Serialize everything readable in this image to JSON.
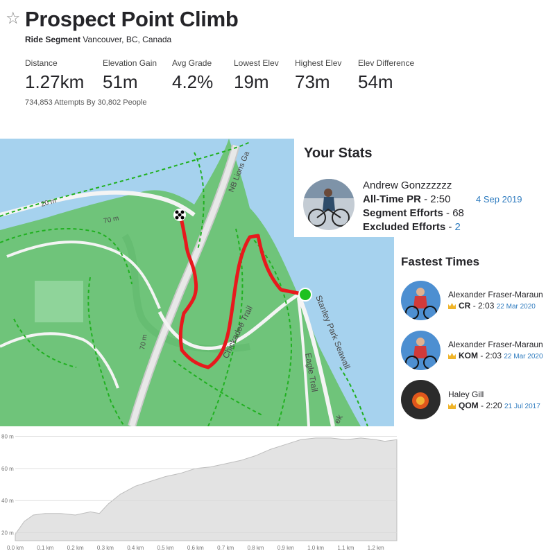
{
  "segment": {
    "star_icon": "☆",
    "title": "Prospect Point Climb",
    "type": "Ride Segment",
    "location": "Vancouver, BC, Canada",
    "attempts": "734,853 Attempts By 30,802 People"
  },
  "stats": [
    {
      "label": "Distance",
      "value": "1.27km"
    },
    {
      "label": "Elevation Gain",
      "value": "51m"
    },
    {
      "label": "Avg Grade",
      "value": "4.2%"
    },
    {
      "label": "Lowest Elev",
      "value": "19m"
    },
    {
      "label": "Highest Elev",
      "value": "73m"
    },
    {
      "label": "Elev Difference",
      "value": "54m"
    }
  ],
  "map": {
    "labels": {
      "lions_gate": "NB Lions Ga",
      "chickadee": "Chickadee Trail",
      "stanley": "Stanley Park Seawall",
      "eagle": "Eagle Trail",
      "contour_70a": "70 m",
      "contour_70b": "70 m",
      "contour_20": "20 m",
      "fragment": "ek"
    },
    "colors": {
      "water": "#a6d2ee",
      "land": "#6fc47a",
      "route": "#e8191d",
      "start": "#1fc11f"
    }
  },
  "your_stats": {
    "title": "Your Stats",
    "name": "Andrew Gonzzzzzz",
    "pr_label": "All-Time PR",
    "pr_value": "- 2:50",
    "pr_date": "4 Sep 2019",
    "efforts_label": "Segment Efforts",
    "efforts_value": "- 68",
    "excluded_label": "Excluded Efforts",
    "excluded_sep": "-",
    "excluded_value": "2"
  },
  "fastest": {
    "title": "Fastest Times",
    "entries": [
      {
        "name": "Alexander Fraser-Maraun",
        "award": "CR",
        "time": "- 2:03",
        "date": "22 Mar 2020"
      },
      {
        "name": "Alexander Fraser-Maraun",
        "award": "KOM",
        "time": "- 2:03",
        "date": "22 Mar 2020"
      },
      {
        "name": "Haley Gill",
        "award": "QOM",
        "time": "- 2:20",
        "date": "21 Jul 2017"
      }
    ]
  },
  "chart_data": {
    "type": "area",
    "ylabels": [
      "20 m",
      "40 m",
      "60 m",
      "80 m"
    ],
    "xlabels": [
      "0.0 km",
      "0.1 km",
      "0.2 km",
      "0.3 km",
      "0.4 km",
      "0.5 km",
      "0.6 km",
      "0.7 km",
      "0.8 km",
      "0.9 km",
      "1.0 km",
      "1.1 km",
      "1.2 km"
    ],
    "ylim": [
      15,
      82
    ],
    "xlim": [
      0,
      1.27
    ],
    "x": [
      0,
      0.03,
      0.06,
      0.1,
      0.15,
      0.2,
      0.25,
      0.28,
      0.31,
      0.35,
      0.4,
      0.45,
      0.5,
      0.55,
      0.6,
      0.65,
      0.7,
      0.75,
      0.8,
      0.85,
      0.9,
      0.95,
      1.0,
      1.05,
      1.1,
      1.15,
      1.2,
      1.23,
      1.27
    ],
    "y": [
      19,
      27,
      31,
      32,
      32,
      31,
      33,
      32,
      38,
      44,
      49,
      52,
      55,
      57,
      60,
      61,
      63,
      65,
      68,
      72,
      75,
      78,
      79,
      79,
      78,
      79,
      78,
      77,
      78
    ]
  }
}
